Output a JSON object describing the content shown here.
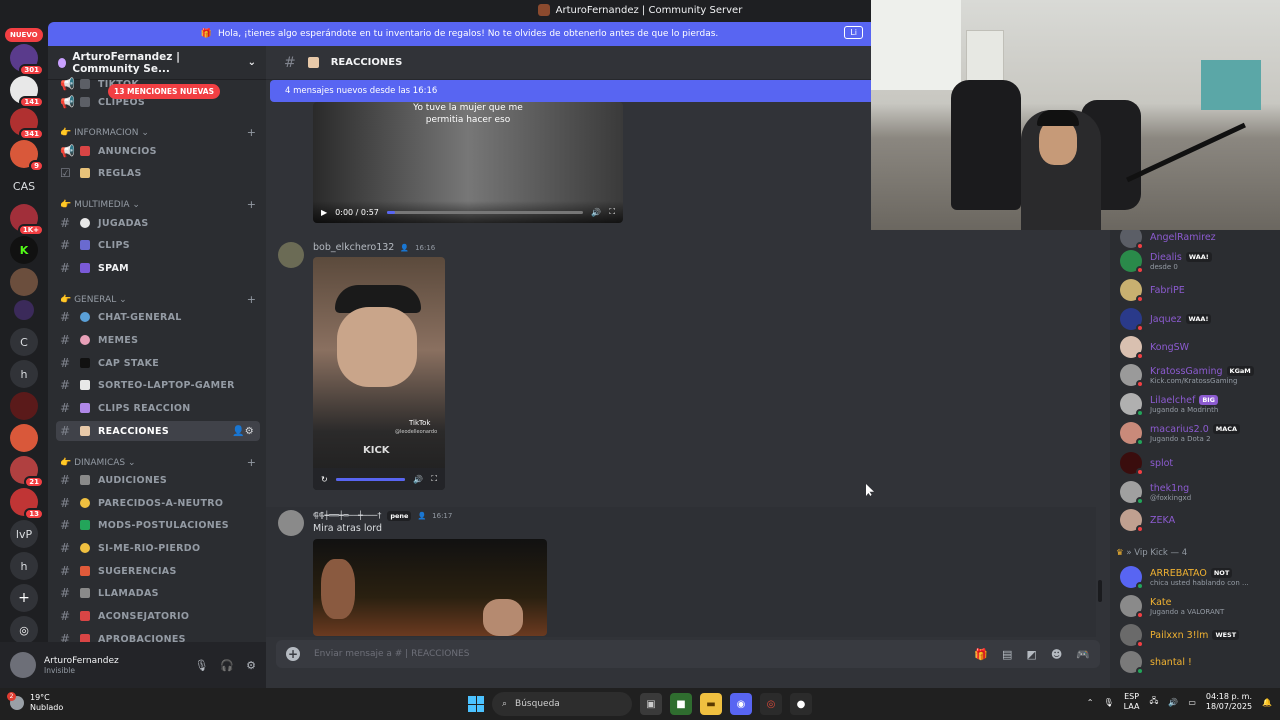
{
  "window": {
    "title": "ArturoFernandez | Community Server"
  },
  "announcement": {
    "text": "Hola, ¡tienes algo esperándote en tu inventario de regalos! No te olvides de obtenerlo antes de que lo pierdas.",
    "cta": "Li"
  },
  "rail": {
    "nuevo": "NUEVO",
    "items": [
      {
        "label": "",
        "badge": "301"
      },
      {
        "label": "",
        "badge": "141"
      },
      {
        "label": "",
        "badge": "341"
      },
      {
        "label": "",
        "badge": "9"
      },
      {
        "label": "CAS",
        "badge": ""
      },
      {
        "label": "",
        "badge": "1K+"
      },
      {
        "label": "",
        "badge": ""
      },
      {
        "label": "",
        "badge": ""
      },
      {
        "label": "",
        "badge": ""
      },
      {
        "label": "C",
        "badge": ""
      },
      {
        "label": "h",
        "badge": ""
      },
      {
        "label": "",
        "badge": ""
      },
      {
        "label": "",
        "badge": ""
      },
      {
        "label": "",
        "badge": "21"
      },
      {
        "label": "",
        "badge": "13"
      },
      {
        "label": "lvP",
        "badge": ""
      },
      {
        "label": "h",
        "badge": ""
      },
      {
        "label": "+",
        "badge": ""
      },
      {
        "label": "",
        "badge": ""
      }
    ]
  },
  "sidebar": {
    "server_name": "ArturoFernandez | Community Se...",
    "mentions": "13 MENCIONES NUEVAS",
    "partial_channels": [
      "TIKTOK",
      "CLIPEOS"
    ],
    "categories": [
      {
        "name": "INFORMACION",
        "channels": [
          "ANUNCIOS",
          "REGLAS"
        ]
      },
      {
        "name": "MULTIMEDIA",
        "channels": [
          "JUGADAS",
          "CLIPS",
          "SPAM"
        ]
      },
      {
        "name": "GENERAL",
        "channels": [
          "CHAT-GENERAL",
          "MEMES",
          "CAP  STAKE",
          "SORTEO-LAPTOP-GAMER",
          "CLIPS  REACCION",
          "REACCIONES"
        ]
      },
      {
        "name": "DINAMICAS",
        "channels": [
          "AUDICIONES",
          "PARECIDOS-A-NEUTRO",
          "MODS-POSTULACIONES",
          "SI-ME-RIO-PIERDO",
          "SUGERENCIAS",
          "LLAMADAS",
          "ACONSEJATORIO",
          "APROBACIONES"
        ]
      }
    ]
  },
  "user_panel": {
    "name": "ArturoFernandez",
    "status": "Invisible"
  },
  "chat": {
    "channel": "REACCIONES",
    "new_messages": "4 mensajes nuevos desde las 16:16",
    "video1": {
      "caption": "Yo tuve la mujer que me permitia hacer eso",
      "time": "0:00 / 0:57"
    },
    "msg2": {
      "author": "bob_elkchero132",
      "time": "16:16",
      "tiktok": "TikTok",
      "kick": "KICK",
      "handle": "@leodelleonardo"
    },
    "msg3": {
      "author": "⸿⸿┿══┿═──┿───†",
      "tag": "pene",
      "time": "16:17",
      "text": "Mira atras lord"
    },
    "composer_placeholder": "Enviar mensaje a #  |  REACCIONES"
  },
  "members": {
    "list": [
      {
        "name": "AngelRamirez",
        "sub": "",
        "tag": ""
      },
      {
        "name": "Diealis",
        "sub": "desde 0",
        "tag": "WAA!"
      },
      {
        "name": "FabriPE",
        "sub": "",
        "tag": ""
      },
      {
        "name": "Jaquez",
        "sub": "",
        "tag": "WAA!"
      },
      {
        "name": "KongSW",
        "sub": "",
        "tag": ""
      },
      {
        "name": "KratossGaming",
        "sub": "Kick.com/KratossGaming",
        "tag": "KGaM"
      },
      {
        "name": "Lilaelchef",
        "sub": "Jugando a Modrinth",
        "tag": "BIG"
      },
      {
        "name": "macarius2.0",
        "sub": "Jugando a Dota 2",
        "tag": "MACA"
      },
      {
        "name": "splot",
        "sub": "",
        "tag": ""
      },
      {
        "name": "thek1ng",
        "sub": "@foxkingxd",
        "tag": ""
      },
      {
        "name": "ZEKA",
        "sub": "",
        "tag": ""
      }
    ],
    "vip_header": "» Vip Kick — 4",
    "vip": [
      {
        "name": "ARREBATAO",
        "sub": "chica usted hablando con ...",
        "tag": "NOT"
      },
      {
        "name": "Kate",
        "sub": "Jugando a VALORANT",
        "tag": ""
      },
      {
        "name": "Pailxxn 3!lm",
        "sub": "",
        "tag": "WEST"
      },
      {
        "name": "shantal !",
        "sub": "",
        "tag": ""
      }
    ]
  },
  "taskbar": {
    "weather_temp": "19°C",
    "weather_desc": "Nublado",
    "weather_badge": "2",
    "search": "Búsqueda",
    "lang1": "ESP",
    "lang2": "LAA",
    "time": "04:18 p. m.",
    "date": "18/07/2025"
  },
  "colors": {
    "accent": "#5865f2",
    "mention": "#f23f43",
    "online": "#23a55a",
    "member_role": "#8c5bd0",
    "vip_role": "#f0b232"
  }
}
